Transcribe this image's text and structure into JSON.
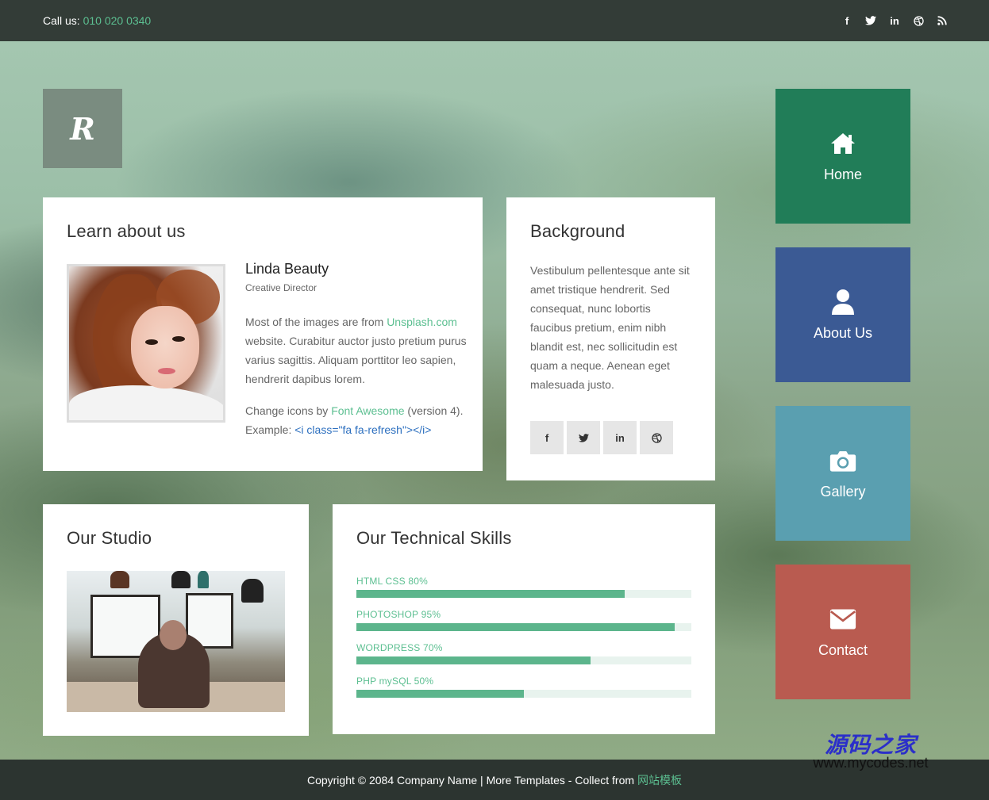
{
  "topbar": {
    "call_label": "Call us:",
    "phone": "010 020 0340",
    "social_icons": [
      "facebook-icon",
      "twitter-icon",
      "linkedin-icon",
      "dribbble-icon",
      "rss-icon"
    ]
  },
  "logo": {
    "letter": "R"
  },
  "learn": {
    "title": "Learn about us",
    "name": "Linda Beauty",
    "role": "Creative Director",
    "p1_prefix": "Most of the images are from ",
    "p1_link": "Unsplash.com",
    "p1_rest": " website. Curabitur auctor justo pretium purus varius sagittis. Aliquam porttitor leo sapien, hendrerit dapibus lorem.",
    "p2_prefix": "Change icons by ",
    "p2_link": "Font Awesome",
    "p2_rest": " (version 4).",
    "example_label": "Example: ",
    "example_code": "<i class=\"fa fa-refresh\"></i>"
  },
  "background": {
    "title": "Background",
    "text": "Vestibulum pellentesque ante sit amet tristique hendrerit. Sed consequat, nunc lobortis faucibus pretium, enim nibh blandit est, nec sollicitudin est quam a neque. Aenean eget malesuada justo.",
    "social": [
      {
        "icon": "facebook-icon",
        "glyph": "f"
      },
      {
        "icon": "twitter-icon",
        "glyph": "t"
      },
      {
        "icon": "linkedin-icon",
        "glyph": "in"
      },
      {
        "icon": "dribbble-icon",
        "glyph": "◎"
      }
    ]
  },
  "studio": {
    "title": "Our Studio"
  },
  "skills": {
    "title": "Our Technical Skills",
    "items": [
      {
        "label": "HTML CSS 80%",
        "value": 0.8
      },
      {
        "label": "PHOTOSHOP 95%",
        "value": 0.95
      },
      {
        "label": "WORDPRESS 70%",
        "value": 0.7
      },
      {
        "label": "PHP mySQL 50%",
        "value": 0.5
      }
    ]
  },
  "nav": {
    "items": [
      {
        "label": "Home",
        "icon": "home-icon",
        "color": "#217d58"
      },
      {
        "label": "About Us",
        "icon": "user-icon",
        "color": "#3b5a94"
      },
      {
        "label": "Gallery",
        "icon": "camera-icon",
        "color": "#5a9fb0"
      },
      {
        "label": "Contact",
        "icon": "envelope-icon",
        "color": "#b95b50"
      }
    ]
  },
  "footer": {
    "text": "Copyright © 2084 Company Name | More Templates - Collect from",
    "link": "网站模板"
  },
  "watermark": {
    "cn": "源码之家",
    "url": "www.mycodes.net"
  },
  "colors": {
    "accent": "#5cbf91",
    "topbar": "#333c37",
    "footer": "#2c3430"
  }
}
